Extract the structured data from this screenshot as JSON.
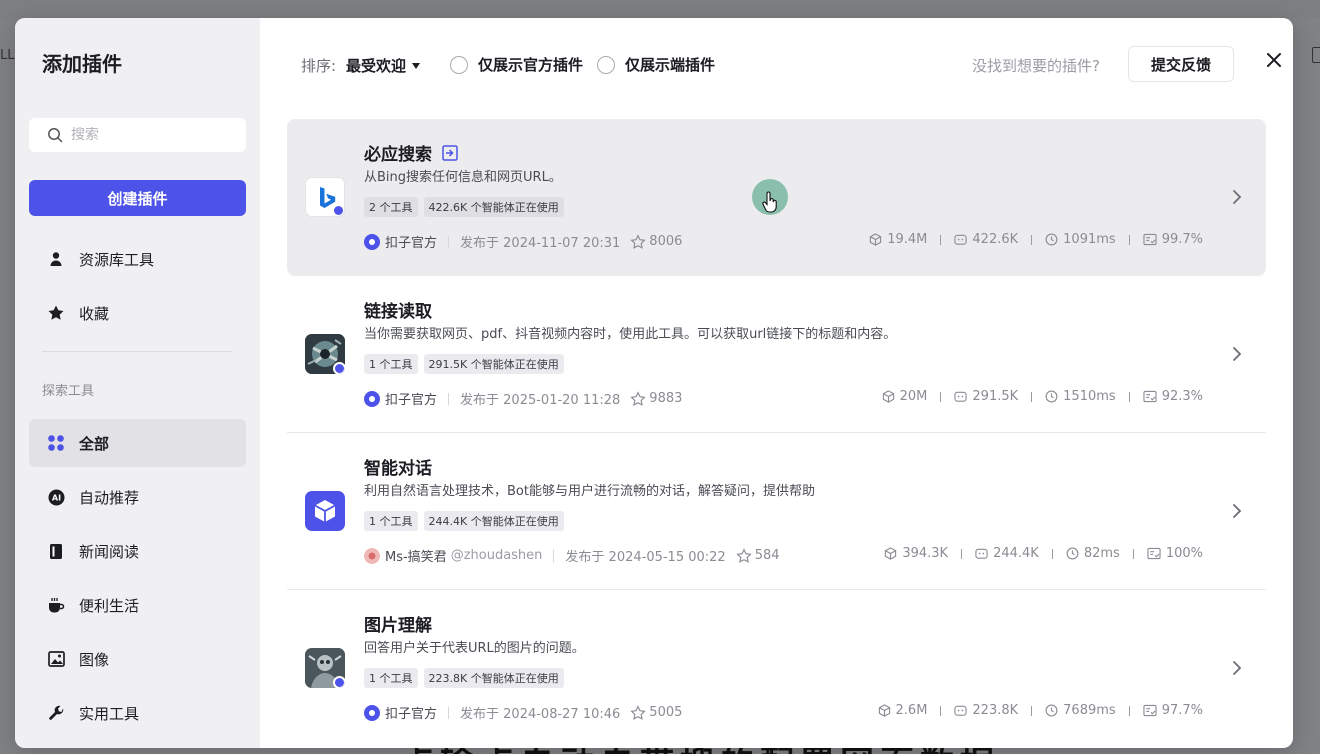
{
  "background": {
    "left_text": "LL",
    "bottom_caption": "点输点自动自带搜的配置网页数据"
  },
  "sidebar": {
    "title": "添加插件",
    "search_placeholder": "搜索",
    "create_button": "创建插件",
    "top_items": [
      {
        "label": "资源库工具",
        "icon": "person-icon"
      },
      {
        "label": "收藏",
        "icon": "star-filled-icon"
      }
    ],
    "section_title": "探索工具",
    "explore_items": [
      {
        "label": "全部",
        "icon": "grid-icon",
        "active": true
      },
      {
        "label": "自动推荐",
        "icon": "ai-icon"
      },
      {
        "label": "新闻阅读",
        "icon": "book-icon"
      },
      {
        "label": "便利生活",
        "icon": "cup-icon"
      },
      {
        "label": "图像",
        "icon": "image-icon"
      },
      {
        "label": "实用工具",
        "icon": "wrench-icon"
      }
    ]
  },
  "topbar": {
    "sort_label": "排序:",
    "sort_value": "最受欢迎",
    "filter_official": "仅展示官方插件",
    "filter_client": "仅展示端插件",
    "not_found_text": "没找到想要的插件?",
    "feedback_button": "提交反馈"
  },
  "plugins": [
    {
      "title": "必应搜索",
      "description": "从Bing搜索任何信息和网页URL。",
      "tags": [
        "2 个工具",
        "422.6K 个智能体正在使用"
      ],
      "author": "扣子官方",
      "handle": "",
      "published": "发布于 2024-11-07 20:31",
      "stars": "8006",
      "stats": [
        "19.4M",
        "422.6K",
        "1091ms",
        "99.7%"
      ],
      "icon": "bing-icon",
      "hover": true
    },
    {
      "title": "链接读取",
      "description": "当你需要获取网页、pdf、抖音视频内容时，使用此工具。可以获取url链接下的标题和内容。",
      "tags": [
        "1 个工具",
        "291.5K 个智能体正在使用"
      ],
      "author": "扣子官方",
      "handle": "",
      "published": "发布于 2025-01-20 11:28",
      "stars": "9883",
      "stats": [
        "20M",
        "291.5K",
        "1510ms",
        "92.3%"
      ],
      "icon": "link-reader-icon",
      "hover": false
    },
    {
      "title": "智能对话",
      "description": "利用自然语言处理技术，Bot能够与用户进行流畅的对话，解答疑问，提供帮助",
      "tags": [
        "1 个工具",
        "244.4K 个智能体正在使用"
      ],
      "author": "Ms-搞笑君",
      "handle": "@zhoudashen",
      "published": "发布于 2024-05-15 00:22",
      "stars": "584",
      "stats": [
        "394.3K",
        "244.4K",
        "82ms",
        "100%"
      ],
      "icon": "cube-icon",
      "hover": false
    },
    {
      "title": "图片理解",
      "description": "回答用户关于代表URL的图片的问题。",
      "tags": [
        "1 个工具",
        "223.8K 个智能体正在使用"
      ],
      "author": "扣子官方",
      "handle": "",
      "published": "发布于 2024-08-27 10:46",
      "stars": "5005",
      "stats": [
        "2.6M",
        "223.8K",
        "7689ms",
        "97.7%"
      ],
      "icon": "image-understanding-icon",
      "hover": false
    }
  ],
  "colors": {
    "accent": "#4d53e8",
    "sidebar_bg": "#f0f0f2",
    "hover_bg": "#ececef"
  }
}
